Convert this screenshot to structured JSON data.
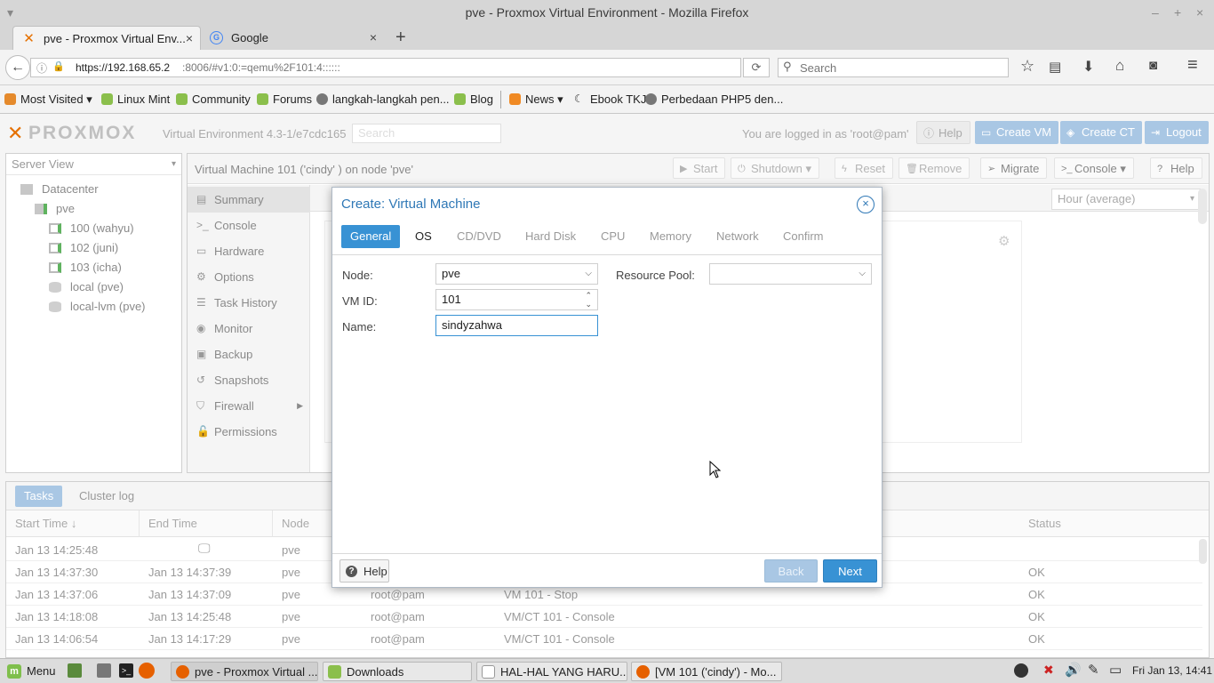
{
  "window": {
    "title": "pve - Proxmox Virtual Environment - Mozilla Firefox"
  },
  "browser": {
    "tabs": [
      {
        "label": "pve - Proxmox Virtual Env..."
      },
      {
        "label": "Google"
      }
    ],
    "url_host": "https://192.168.65.2",
    "url_rest": ":8006/#v1:0:=qemu%2F101:4::::::",
    "search_placeholder": "Search",
    "bookmarks": [
      "Most Visited",
      "Linux Mint",
      "Community",
      "Forums",
      "langkah-langkah pen...",
      "Blog",
      "News",
      "Ebook TKJ",
      "Perbedaan PHP5 den..."
    ]
  },
  "pve": {
    "logo": "PROXMOX",
    "version": "Virtual Environment 4.3-1/e7cdc165",
    "search_placeholder": "Search",
    "logged_in": "You are logged in as 'root@pam'",
    "help": "Help",
    "create_vm": "Create VM",
    "create_ct": "Create CT",
    "logout": "Logout",
    "view": "Server View",
    "tree": {
      "datacenter": "Datacenter",
      "node": "pve",
      "items": [
        "100 (wahyu)",
        "102 (juni)",
        "103 (icha)",
        "local (pve)",
        "local-lvm (pve)"
      ]
    },
    "content_title": "Virtual Machine 101 ('cindy' ) on node 'pve'",
    "toolbar": {
      "start": "Start",
      "shutdown": "Shutdown",
      "reset": "Reset",
      "remove": "Remove",
      "migrate": "Migrate",
      "console": "Console",
      "help": "Help"
    },
    "menu": [
      "Summary",
      "Console",
      "Hardware",
      "Options",
      "Task History",
      "Monitor",
      "Backup",
      "Snapshots",
      "Firewall",
      "Permissions"
    ],
    "timeframe": "Hour (average)",
    "bottom_tabs": {
      "tasks": "Tasks",
      "cluster_log": "Cluster log"
    },
    "task_columns": {
      "start": "Start Time ↓",
      "end": "End Time",
      "node": "Node",
      "status": "Status"
    },
    "tasks": [
      {
        "start": "Jan 13 14:25:48",
        "end": "",
        "node": "pve",
        "user": "",
        "desc": "",
        "status": ""
      },
      {
        "start": "Jan 13 14:37:30",
        "end": "Jan 13 14:37:39",
        "node": "pve",
        "user": "",
        "desc": "",
        "status": "OK"
      },
      {
        "start": "Jan 13 14:37:06",
        "end": "Jan 13 14:37:09",
        "node": "pve",
        "user": "root@pam",
        "desc": "VM 101 - Stop",
        "status": "OK"
      },
      {
        "start": "Jan 13 14:18:08",
        "end": "Jan 13 14:25:48",
        "node": "pve",
        "user": "root@pam",
        "desc": "VM/CT 101 - Console",
        "status": "OK"
      },
      {
        "start": "Jan 13 14:06:54",
        "end": "Jan 13 14:17:29",
        "node": "pve",
        "user": "root@pam",
        "desc": "VM/CT 101 - Console",
        "status": "OK"
      }
    ]
  },
  "dialog": {
    "title": "Create: Virtual Machine",
    "tabs": [
      "General",
      "OS",
      "CD/DVD",
      "Hard Disk",
      "CPU",
      "Memory",
      "Network",
      "Confirm"
    ],
    "node_label": "Node:",
    "node_value": "pve",
    "vmid_label": "VM ID:",
    "vmid_value": "101",
    "name_label": "Name:",
    "name_value": "sindyzahwa",
    "pool_label": "Resource Pool:",
    "pool_value": "",
    "help": "Help",
    "back": "Back",
    "next": "Next"
  },
  "taskbar": {
    "menu": "Menu",
    "windows": [
      "pve - Proxmox Virtual ...",
      "Downloads",
      "HAL-HAL YANG HARU...",
      "[VM 101 ('cindy') - Mo..."
    ],
    "clock": "Fri Jan 13, 14:41"
  },
  "colors": {
    "accent": "#3892d4",
    "proxmox_orange": "#e57000"
  }
}
